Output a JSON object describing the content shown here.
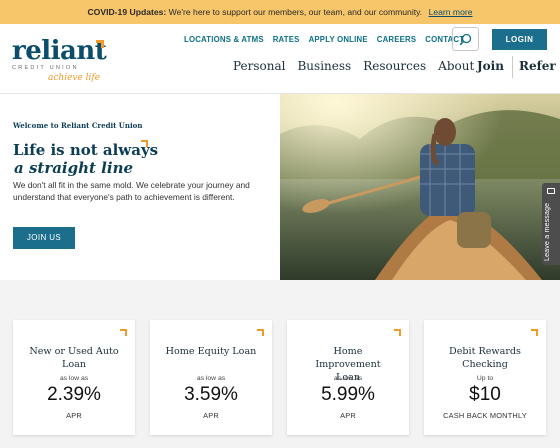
{
  "covid": {
    "bold": "COVID-19 Updates:",
    "text": "We're here to support our members, our team, and our community.",
    "link": "Learn more"
  },
  "logo": {
    "name": "reliant",
    "sub": "CREDIT UNION",
    "tagline": "achieve life"
  },
  "util_nav": [
    "LOCATIONS & ATMS",
    "RATES",
    "APPLY ONLINE",
    "CAREERS",
    "CONTACT"
  ],
  "login_label": "LOGIN",
  "main_nav": [
    "Personal",
    "Business",
    "Resources",
    "About"
  ],
  "secondary_nav": [
    "Join",
    "Refer"
  ],
  "hero": {
    "welcome": "Welcome to Reliant Credit Union",
    "headline_line1": "Life is not always",
    "headline_line2": "a straight line",
    "body": "We don't all fit in the same mold. We celebrate your journey and understand that everyone's path to achievement is different.",
    "cta": "JOIN US"
  },
  "leave_message": "Leave a message",
  "cards": [
    {
      "title": "New or Used Auto Loan",
      "prefix": "as low as",
      "value": "2.39%",
      "suffix": "APR"
    },
    {
      "title": "Home Equity Loan",
      "prefix": "as low as",
      "value": "3.59%",
      "suffix": "APR"
    },
    {
      "title": "Home Improvement Loan",
      "prefix": "as low as",
      "value": "5.99%",
      "suffix": "APR"
    },
    {
      "title": "Debit Rewards Checking",
      "prefix": "Up to",
      "value": "$10",
      "suffix": "CASH BACK MONTHLY"
    }
  ],
  "colors": {
    "brand_teal": "#1b6f8d",
    "brand_navy": "#0b3d55",
    "accent_orange": "#f09a28",
    "covid_bar": "#f8c66a"
  },
  "icons": {
    "search": "search-icon",
    "chat": "chat-icon"
  }
}
